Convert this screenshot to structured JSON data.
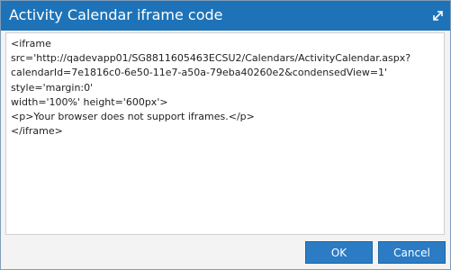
{
  "dialog": {
    "title": "Activity Calendar iframe code",
    "maximize_icon": "expand-arrows-icon"
  },
  "code": {
    "lines": [
      "<iframe",
      "src='http://qadevapp01/SG8811605463ECSU2/Calendars/ActivityCalendar.aspx?",
      "calendarId=7e1816c0-6e50-11e7-a50a-79eba40260e2&condensedView=1'",
      "style='margin:0'",
      "width='100%' height='600px'>",
      "<p>Your browser does not support iframes.</p>",
      "</iframe>"
    ]
  },
  "buttons": {
    "ok_label": "OK",
    "cancel_label": "Cancel"
  },
  "colors": {
    "titlebar": "#1e73b8",
    "button": "#2b7cc4"
  }
}
